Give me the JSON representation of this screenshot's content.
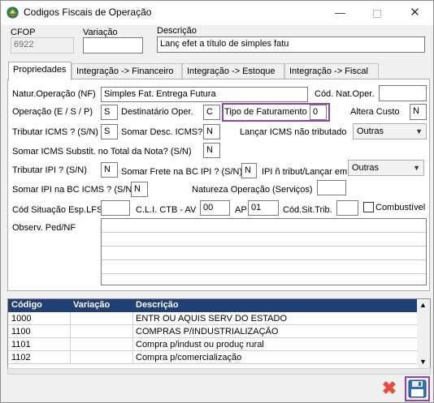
{
  "window": {
    "title": "Codigos Fiscais de Operação",
    "minimize": "—",
    "close": "✕"
  },
  "header": {
    "cfop_label": "CFOP",
    "cfop_value": "6922",
    "variacao_label": "Variação",
    "variacao_value": "",
    "descricao_label": "Descrição",
    "descricao_value": "Lanç efet a título de simples fatu"
  },
  "tabs": [
    {
      "label": "Propriedades",
      "active": true
    },
    {
      "label": "Integração -> Financeiro",
      "active": false
    },
    {
      "label": "Integração -> Estoque",
      "active": false
    },
    {
      "label": "Integração -> Fiscal",
      "active": false
    }
  ],
  "props": {
    "natur_label": "Natur.Operação (NF)",
    "natur_value": "Simples Fat. Entrega Futura",
    "cod_nat_label": "Cód. Nat.Oper.",
    "cod_nat_value": "",
    "operacao_label": "Operação (E / S / P)",
    "operacao_value": "S",
    "destinatario_label": "Destinatário Oper.",
    "destinatario_value": "C",
    "tipo_fat_label": "Tipo de Faturamento",
    "tipo_fat_value": "0",
    "altera_custo_label": "Altera Custo",
    "altera_custo_value": "N",
    "trib_icms_label": "Tributar ICMS ? (S/N)",
    "trib_icms_value": "S",
    "somar_desc_label": "Somar Desc. ICMS?",
    "somar_desc_value": "N",
    "lancar_icms_label": "Lançar ICMS não tributado",
    "lancar_icms_value": "Outras",
    "somar_subst_label": "Somar ICMS Substit. no Total da Nota? (S/N)",
    "somar_subst_value": "N",
    "trib_ipi_label": "Tributar IPI ? (S/N)",
    "trib_ipi_value": "N",
    "somar_frete_label": "Somar Frete na BC IPI ? (S/N)",
    "somar_frete_value": "N",
    "ipi_trib_label": "IPI ñ tribut/Lançar em",
    "ipi_trib_value": "Outras",
    "somar_ipi_label": "Somar IPI na BC ICMS ? (S/N)",
    "somar_ipi_value": "N",
    "natureza_label": "Natureza Operação (Serviços)",
    "natureza_value": "",
    "cod_sit_lfs_label": "Cód Situação Esp.LFS",
    "cod_sit_lfs_value": "",
    "cli_label": "C.L.I. CTB - AV",
    "cli_value": "00",
    "ap_label": "AP",
    "ap_value": "01",
    "cod_sit_trib_label": "Cód.Sit.Trib.",
    "cod_sit_trib_value": "",
    "combustivel_label": "Combustível",
    "observ_label": "Observ. Ped/NF"
  },
  "grid": {
    "columns": [
      "Código",
      "Variação",
      "Descrição"
    ],
    "rows": [
      {
        "codigo": "1000",
        "variacao": "",
        "descricao": "ENTR OU AQUIS SERV DO ESTADO"
      },
      {
        "codigo": "1100",
        "variacao": "",
        "descricao": "COMPRAS P/INDUSTRIALIZAÇÃO"
      },
      {
        "codigo": "1101",
        "variacao": "",
        "descricao": "Compra p/indust ou produç rural"
      },
      {
        "codigo": "1102",
        "variacao": "",
        "descricao": "Compra p/comercialização"
      }
    ]
  },
  "colors": {
    "grid_header": "#1f3f75",
    "highlight": "#8e44ad",
    "cancel": "#e74c3c",
    "save": "#2e6fb5"
  }
}
